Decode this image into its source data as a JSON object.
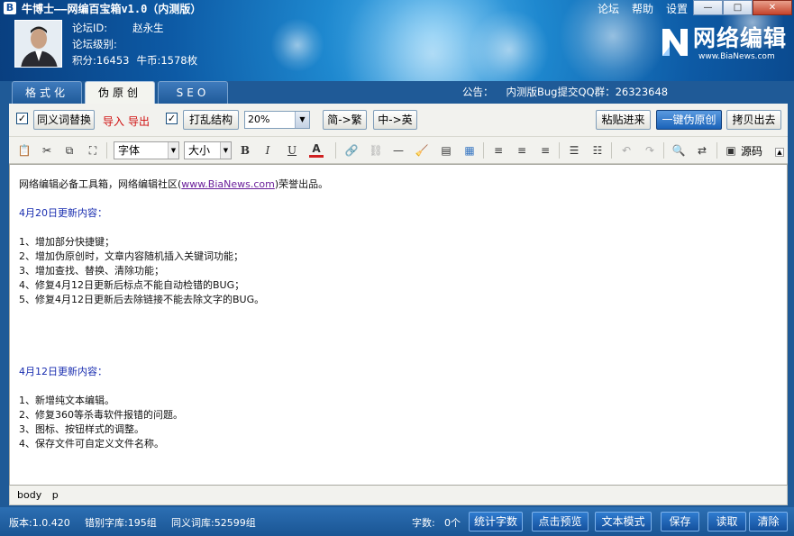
{
  "app": {
    "title": "牛博士——网编百宝箱v1.0（内测版）",
    "top_links": [
      "论坛",
      "帮助",
      "设置"
    ],
    "window_buttons": [
      "—",
      "□",
      "✕"
    ]
  },
  "user": {
    "id_label": "论坛ID:",
    "id_value": "赵永生",
    "level_label": "论坛级别:",
    "points": "积分:16453",
    "coins": "牛币:1578枚"
  },
  "logo": {
    "cn": "网络编辑",
    "url": "www.BiaNews.com"
  },
  "tabs": [
    {
      "label": "格式化",
      "active": false
    },
    {
      "label": "伪原创",
      "active": true
    },
    {
      "label": "SEO",
      "active": false
    }
  ],
  "notice": {
    "label": "公告：",
    "text": "内测版Bug提交QQ群：26323648"
  },
  "toolbar": {
    "synonym_checked": true,
    "synonym_label": "同义词替换",
    "import_label": "导入",
    "export_label": "导出",
    "shuffle_checked": true,
    "shuffle_label": "打乱结构",
    "percent": "20%",
    "simp_trad": "简->繁",
    "cn_en": "中->英",
    "paste_in": "粘贴进来",
    "one_click": "一键伪原创",
    "copy_out": "拷贝出去"
  },
  "editor_toolbar": {
    "font": "字体",
    "size": "大小",
    "bold": "B",
    "italic": "I",
    "underline": "U",
    "font_color": "A",
    "source": "源码"
  },
  "content": {
    "intro_before": "网络编辑必备工具箱，网络编辑社区(",
    "intro_link": "www.BiaNews.com",
    "intro_after": ")荣誉出品。",
    "update1_title": "4月20日更新内容：",
    "update1_items": [
      "1、增加部分快捷键；",
      "2、增加伪原创时，文章内容随机插入关键词功能；",
      "3、增加查找、替换、清除功能；",
      "4、修复4月12日更新后标点不能自动检错的BUG；",
      "5、修复4月12日更新后去除链接不能去除文字的BUG。"
    ],
    "update2_title": "4月12日更新内容：",
    "update2_items": [
      "1、新增纯文本编辑。",
      "2、修复360等杀毒软件报错的问题。",
      "3、图标、按钮样式的调整。",
      "4、保存文件可自定义文件名称。"
    ]
  },
  "statusbar": {
    "path": "body p"
  },
  "footer": {
    "version": "版本:1.0.420",
    "typo_lib": "错别字库:195组",
    "synonym_lib": "同义词库:52599组",
    "word_count_label": "字数:",
    "word_count": "0个",
    "buttons": [
      "统计字数",
      "点击预览",
      "文本模式",
      "保存",
      "读取",
      "清除"
    ]
  },
  "colors": {
    "header_blue": "#0d5aa5",
    "footer_blue": "#1a5594",
    "heading_text": "#1a2eb0",
    "import_export_red": "#d01010",
    "link_purple": "#6a1f9a"
  }
}
